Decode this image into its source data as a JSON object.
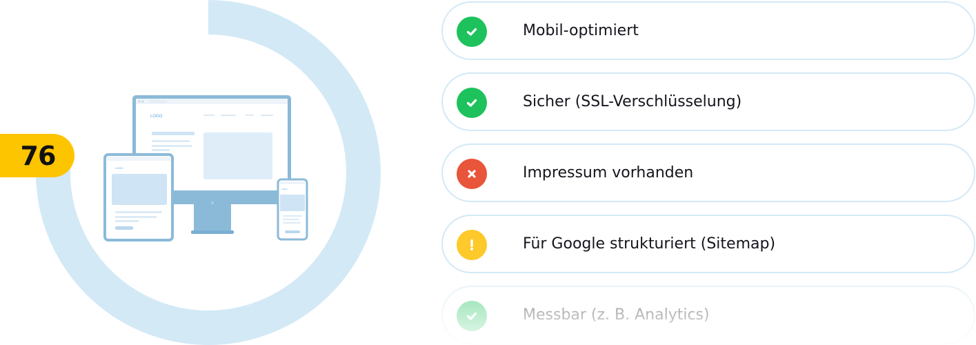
{
  "score": {
    "value": "76",
    "ring_fraction": 0.76,
    "badge_color": "#fdc400",
    "ring_color": "#d3e9f6"
  },
  "devices": {
    "logo_text": "LOGO"
  },
  "checklist": {
    "items": [
      {
        "label": "Mobil-optimiert",
        "status": "pass",
        "icon": "check-icon",
        "color": "#1ec25d"
      },
      {
        "label": "Sicher (SSL-Verschlüsselung)",
        "status": "pass",
        "icon": "check-icon",
        "color": "#1ec25d"
      },
      {
        "label": "Impressum vorhanden",
        "status": "fail",
        "icon": "cross-icon",
        "color": "#e8553a"
      },
      {
        "label": "Für Google strukturiert (Sitemap)",
        "status": "warning",
        "icon": "exclamation-icon",
        "color": "#fdc92b"
      },
      {
        "label": "Messbar (z. B. Analytics)",
        "status": "pass",
        "icon": "check-icon",
        "color": "#1ec25d"
      }
    ]
  }
}
